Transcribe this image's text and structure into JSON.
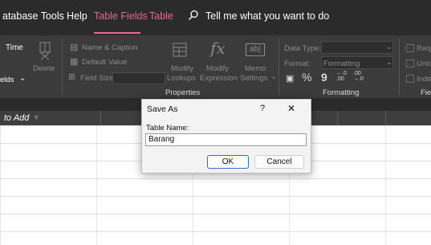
{
  "menubar": {
    "items": [
      "atabase Tools",
      "Help",
      "Table Fields",
      "Table"
    ],
    "search_text": "Tell me what you want to do"
  },
  "ribbon": {
    "views_group": {
      "time_label": "Time",
      "delete_label": "Delete",
      "fields_label": "elds"
    },
    "properties_group": {
      "name_caption": "Name & Caption",
      "default_value": "Default Value",
      "field_size": "Field Size",
      "modify_lookups_1": "Modify",
      "modify_lookups_2": "Lookups",
      "modify_expression_1": "Modify",
      "modify_expression_2": "Expression",
      "memo_settings_1": "Memo",
      "memo_settings_2": "Settings",
      "group_label": "Properties"
    },
    "formatting_group": {
      "data_type_label": "Data Type:",
      "format_label": "Format:",
      "format_value": "Formatting",
      "percent": "%",
      "comma": "9",
      "inc_decimals": "←.0\n.00",
      "dec_decimals": ".00\n→.0",
      "group_label": "Formatting"
    },
    "validation_group": {
      "req_label": "Requ",
      "uni_label": "Uniq",
      "ind_label": "Inde",
      "group_label": "Fie"
    }
  },
  "table": {
    "column_header": "to Add"
  },
  "dialog": {
    "title": "Save As",
    "help": "?",
    "close": "✕",
    "field_label": "Table Name:",
    "field_value": "Barang",
    "ok": "OK",
    "cancel": "Cancel"
  }
}
